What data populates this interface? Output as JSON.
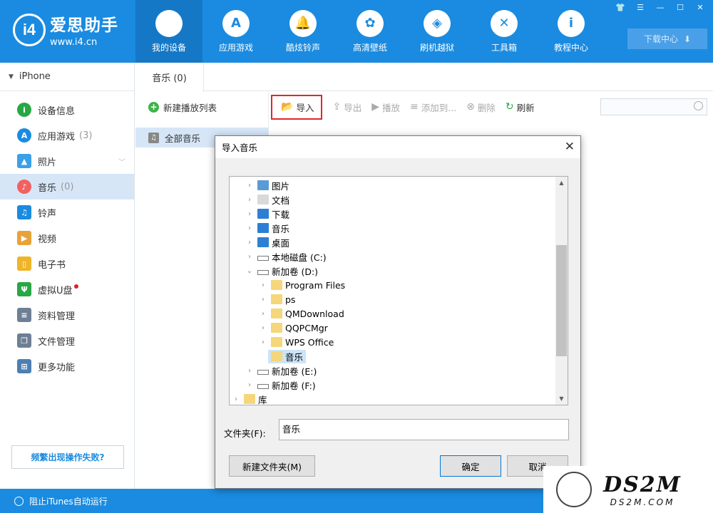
{
  "app": {
    "logo_mark": "i4",
    "name": "爱思助手",
    "url": "www.i4.cn",
    "brand_color": "#1a8be0"
  },
  "nav": [
    {
      "label": "我的设备",
      "icon": "apple-icon",
      "glyph": ""
    },
    {
      "label": "应用游戏",
      "icon": "app-store-icon",
      "glyph": "A"
    },
    {
      "label": "酷炫铃声",
      "icon": "bell-icon",
      "glyph": "🔔"
    },
    {
      "label": "高清壁纸",
      "icon": "flower-icon",
      "glyph": "✿"
    },
    {
      "label": "刷机越狱",
      "icon": "box-icon",
      "glyph": "◈"
    },
    {
      "label": "工具箱",
      "icon": "tools-icon",
      "glyph": "✕"
    },
    {
      "label": "教程中心",
      "icon": "info-icon",
      "glyph": "i"
    }
  ],
  "download_center": "下载中心",
  "sidebar": {
    "device": "iPhone",
    "items": [
      {
        "label": "设备信息",
        "count": "",
        "icon": "info-icon",
        "color": "#28a745",
        "glyph": "i"
      },
      {
        "label": "应用游戏",
        "count": "(3)",
        "icon": "app-store-icon",
        "color": "#1a8be0",
        "glyph": "A"
      },
      {
        "label": "照片",
        "count": "",
        "icon": "photo-icon",
        "color": "#3aa0e8",
        "glyph": "▲"
      },
      {
        "label": "音乐",
        "count": "(0)",
        "icon": "music-icon",
        "color": "#f26060",
        "glyph": "♪"
      },
      {
        "label": "铃声",
        "count": "",
        "icon": "bell-icon",
        "color": "#1a8be0",
        "glyph": "♫"
      },
      {
        "label": "视频",
        "count": "",
        "icon": "video-icon",
        "color": "#e8a23a",
        "glyph": "▶"
      },
      {
        "label": "电子书",
        "count": "",
        "icon": "book-icon",
        "color": "#f0b429",
        "glyph": "▯"
      },
      {
        "label": "虚拟U盘",
        "count": "",
        "icon": "usb-icon",
        "color": "#28a745",
        "glyph": "Ψ"
      },
      {
        "label": "资料管理",
        "count": "",
        "icon": "contacts-icon",
        "color": "#6d7f94",
        "glyph": "≡"
      },
      {
        "label": "文件管理",
        "count": "",
        "icon": "file-icon",
        "color": "#6d7f94",
        "glyph": "❐"
      },
      {
        "label": "更多功能",
        "count": "",
        "icon": "grid-icon",
        "color": "#4d7fb3",
        "glyph": "⊞"
      }
    ],
    "fail_button": "频繁出现操作失败?"
  },
  "footer": {
    "itunes_label": "阻止iTunes自动运行"
  },
  "content": {
    "tab_label": "音乐 (0)",
    "new_playlist": "新建播放列表",
    "all_music": "全部音乐",
    "toolbar": {
      "import": "导入",
      "export": "导出",
      "play": "播放",
      "add_to": "添加到...",
      "delete": "删除",
      "refresh": "刷新"
    },
    "search_placeholder": ""
  },
  "dialog": {
    "title": "导入音乐",
    "tree": [
      {
        "label": "图片",
        "level": 1,
        "expanded": false,
        "icon": "pictures-icon",
        "selected": false
      },
      {
        "label": "文档",
        "level": 1,
        "expanded": false,
        "icon": "documents-icon",
        "selected": false
      },
      {
        "label": "下载",
        "level": 1,
        "expanded": false,
        "icon": "downloads-icon",
        "selected": false
      },
      {
        "label": "音乐",
        "level": 1,
        "expanded": false,
        "icon": "music-icon",
        "selected": false
      },
      {
        "label": "桌面",
        "level": 1,
        "expanded": false,
        "icon": "desktop-icon",
        "selected": false
      },
      {
        "label": "本地磁盘 (C:)",
        "level": 1,
        "expanded": false,
        "icon": "drive-icon",
        "selected": false
      },
      {
        "label": "新加卷 (D:)",
        "level": 1,
        "expanded": true,
        "icon": "drive-icon",
        "selected": false
      },
      {
        "label": "Program Files",
        "level": 2,
        "expanded": false,
        "icon": "folder-icon",
        "selected": false
      },
      {
        "label": "ps",
        "level": 2,
        "expanded": false,
        "icon": "folder-icon",
        "selected": false
      },
      {
        "label": "QMDownload",
        "level": 2,
        "expanded": false,
        "icon": "folder-icon",
        "selected": false
      },
      {
        "label": "QQPCMgr",
        "level": 2,
        "expanded": false,
        "icon": "folder-icon",
        "selected": false
      },
      {
        "label": "WPS Office",
        "level": 2,
        "expanded": false,
        "icon": "folder-icon",
        "selected": false
      },
      {
        "label": "音乐",
        "level": 2,
        "expanded": null,
        "icon": "folder-icon",
        "selected": true
      },
      {
        "label": "新加卷 (E:)",
        "level": 1,
        "expanded": false,
        "icon": "drive-icon",
        "selected": false
      },
      {
        "label": "新加卷 (F:)",
        "level": 1,
        "expanded": false,
        "icon": "drive-icon",
        "selected": false
      },
      {
        "label": "库",
        "level": 0,
        "expanded": false,
        "icon": "library-icon",
        "selected": false
      }
    ],
    "folder_label": "文件夹(F):",
    "folder_value": "音乐",
    "new_folder_button": "新建文件夹(M)",
    "ok_button": "确定",
    "cancel_button": "取消"
  },
  "watermark": {
    "main": "DS2M",
    "sub": "DS2M.COM"
  }
}
